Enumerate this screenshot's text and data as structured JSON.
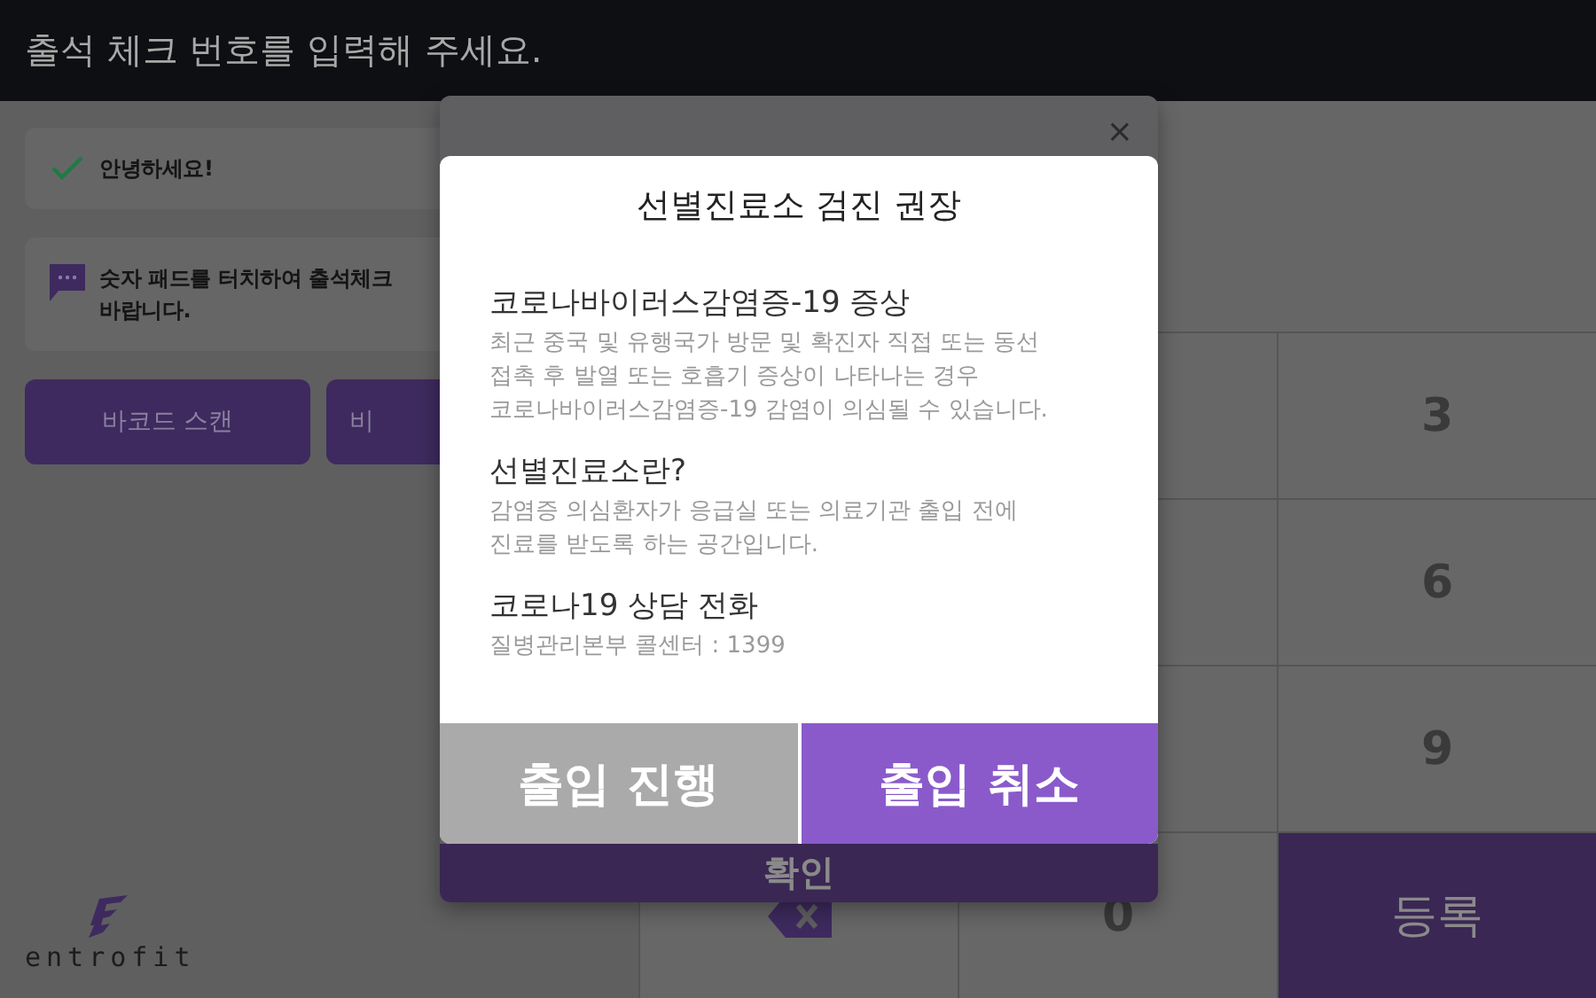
{
  "header": {
    "title": "출석 체크 번호를 입력해 주세요."
  },
  "messages": [
    {
      "kind": "success",
      "lines": [
        "안녕하세요!"
      ]
    },
    {
      "kind": "chat",
      "lines": [
        "숫자 패드를 터치하여 출석체크",
        "바랍니다."
      ]
    }
  ],
  "buttons": [
    "바코드 스캔",
    "비"
  ],
  "logo": {
    "text": "entrofit"
  },
  "keypad": {
    "rows": [
      {
        "keys": [
          {
            "kind": "covered"
          },
          {
            "kind": "covered"
          },
          {
            "kind": "digit",
            "label": "3"
          }
        ]
      },
      {
        "keys": [
          {
            "kind": "covered"
          },
          {
            "kind": "covered"
          },
          {
            "kind": "digit",
            "label": "6"
          }
        ]
      },
      {
        "keys": [
          {
            "kind": "covered"
          },
          {
            "kind": "covered"
          },
          {
            "kind": "digit",
            "label": "9"
          }
        ]
      },
      {
        "keys": [
          {
            "kind": "backspace"
          },
          {
            "kind": "digit",
            "label": "0"
          },
          {
            "kind": "submit",
            "label": "등록"
          }
        ]
      }
    ]
  },
  "back_dialog": {
    "close": "×",
    "button": "확인"
  },
  "dialog": {
    "title": "선별진료소 검진 권장",
    "sections": [
      {
        "heading": "코로나바이러스감염증-19 증상",
        "lines": [
          "최근 중국 및 유행국가 방문 및 확진자 직접 또는 동선",
          "접촉 후 발열 또는 호흡기 증상이 나타나는 경우",
          "코로나바이러스감염증-19 감염이 의심될 수 있습니다."
        ]
      },
      {
        "heading": "선별진료소란?",
        "lines": [
          "감염증 의심환자가 응급실 또는 의료기관 출입 전에",
          "진료를 받도록 하는 공간입니다."
        ]
      },
      {
        "heading": "코로나19 상담 전화",
        "lines": [
          "질병관리본부 콜센터 : 1399"
        ]
      }
    ],
    "buttons": [
      {
        "label": "출입 진행",
        "kind": "secondary"
      },
      {
        "label": "출입 취소",
        "kind": "primary"
      }
    ]
  }
}
